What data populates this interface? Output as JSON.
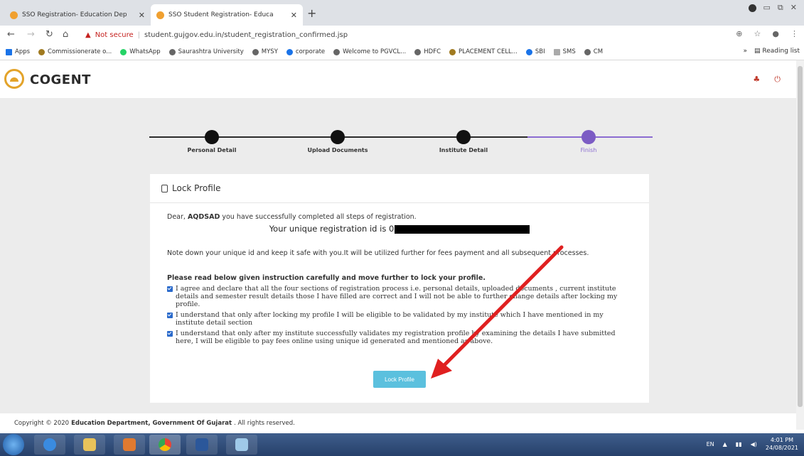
{
  "browser": {
    "tabs": [
      {
        "title": "SSO Registration- Education Dep"
      },
      {
        "title": "SSO Student Registration- Educa"
      }
    ],
    "not_secure": "Not secure",
    "url": "student.gujgov.edu.in/student_registration_confirmed.jsp",
    "bookmarks": [
      "Apps",
      "Commissionerate o...",
      "WhatsApp",
      "Saurashtra University",
      "MYSY",
      "corporate",
      "Welcome to PGVCL...",
      "HDFC",
      "PLACEMENT CELL...",
      "SBI",
      "SMS",
      "CM"
    ],
    "reading_list": "Reading list"
  },
  "site": {
    "brand": "COGENT"
  },
  "steps": [
    {
      "label": "Personal Detail"
    },
    {
      "label": "Upload Documents"
    },
    {
      "label": "Institute Detail"
    },
    {
      "label": "Finish"
    }
  ],
  "card": {
    "title": "Lock Profile",
    "dear_prefix": "Dear, ",
    "name": "AQDSAD",
    "dear_suffix": " you have successfully completed all steps of registration.",
    "uid_text": "Your unique registration id is 0",
    "note": "Note down your unique id and keep it safe with you.It will be utilized further for fees payment and all subsequent processes.",
    "instruction_heading": "Please read below given instruction carefully and move further to lock your profile.",
    "checks": [
      "I agree and declare that all the four sections of registration process i.e. personal details, uploaded documents , current institute details and semester result details those I have filled are correct and I will not be able to further change details after locking my profile.",
      "I understand that only after locking my profile I will be eligible to be validated by my institute which I have mentioned in my institute detail section",
      "I understand that only after my institute successfully validates my registration profile by examining the details I have submitted here, I will be eligible to pay fees online using unique id generated and mentioned as above."
    ],
    "button": "Lock Profile"
  },
  "footer": {
    "prefix": "Copyright © 2020",
    "org": "Education Department, Government Of Gujarat",
    "suffix": ". All rights reserved."
  },
  "taskbar": {
    "lang": "EN",
    "time": "4:01 PM",
    "date": "24/08/2021"
  },
  "colors": {
    "accent": "#5bc0de",
    "step_active": "#7c5cc4",
    "checkbox": "#2a6acb",
    "arrow": "#e02020"
  }
}
